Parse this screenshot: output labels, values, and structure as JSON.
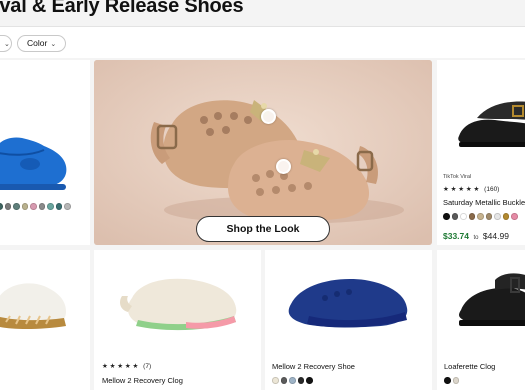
{
  "header": {
    "title": "ival & Early Release Shoes"
  },
  "filters": [
    {
      "label": ""
    },
    {
      "label": "Color"
    }
  ],
  "cards": {
    "top_left": {
      "swatches": [
        "#3f6560",
        "#7a7a7a",
        "#5f7f7b",
        "#b9b18e",
        "#d79ab0",
        "#8b8b8b",
        "#6aa69f",
        "#3a6e70",
        "#b7b7b7"
      ]
    },
    "hero": {
      "cta": "Shop the Look",
      "background": "#e8d2c4"
    },
    "top_right": {
      "tag": "TikTok Viral",
      "rating_stars": "★ ★ ★ ★ ★",
      "rating_count": "(160)",
      "name": "Saturday Metallic Buckle",
      "price_sale": "$33.74",
      "price_to": "to",
      "price_orig": "$44.99",
      "swatches": [
        "#111111",
        "#5a5a5a",
        "#ffffff",
        "#8a6a4a",
        "#c7b38f",
        "#a08a6a",
        "#e6e6e6",
        "#b38a2f",
        "#e58aa5"
      ]
    },
    "bottom_2": {
      "rating_stars": "★ ★ ★ ★ ★",
      "rating_count": "(7)",
      "name": "Mellow 2 Recovery Clog"
    },
    "bottom_3": {
      "name": "Mellow 2 Recovery Shoe",
      "swatches": [
        "#ece6d6",
        "#5b5b5b",
        "#9fb4c7",
        "#2a2a2a",
        "#141414"
      ]
    },
    "bottom_4": {
      "name": "Loaferette Clog",
      "swatches": [
        "#111111",
        "#dcd6cb"
      ]
    }
  },
  "colors": {
    "sale_green": "#1f7a35"
  }
}
